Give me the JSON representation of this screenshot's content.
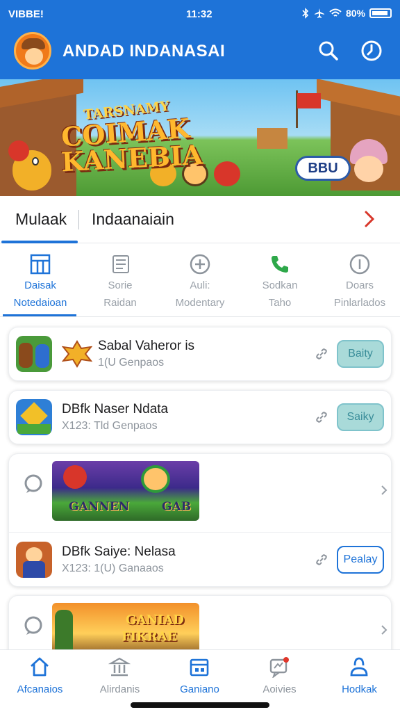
{
  "status_bar": {
    "carrier": "VIBBE!",
    "time": "11:32",
    "battery": "80%"
  },
  "header": {
    "title": "ANDAD INDANASAI",
    "icons": [
      "search-icon",
      "history-icon"
    ]
  },
  "banner": {
    "line1": "TARSNAMY",
    "line2": "COIMAK",
    "line3": "KANEBIA",
    "badge": "BBU"
  },
  "section_tabs": {
    "active": "Mulaak",
    "other": "Indaanaiain"
  },
  "categories": [
    {
      "line1": "Daisak",
      "line2": "Notedaioan",
      "icon": "grid-icon",
      "active": true
    },
    {
      "line1": "Sorie",
      "line2": "Raidan",
      "icon": "list-icon",
      "active": false
    },
    {
      "line1": "Auli:",
      "line2": "Modentary",
      "icon": "add-circle-icon",
      "active": false
    },
    {
      "line1": "Sodkan",
      "line2": "Taho",
      "icon": "phone-icon",
      "active": false
    },
    {
      "line1": "Doars",
      "line2": "Pinlarlados",
      "icon": "info-circle-icon",
      "active": false
    }
  ],
  "games": [
    {
      "title": "Sabal Vaheror is",
      "subtitle": "1(U  Genpaos",
      "button": "Baity",
      "icon": "game-thumb-1"
    },
    {
      "title": "DBfk  Naser Ndata",
      "subtitle": "X123:  Tld Genpaos",
      "button": "Saiky",
      "icon": "game-thumb-2"
    },
    {
      "title": "DBfk  Saiye: Nelasa",
      "subtitle": "X123:  1(U) Ganaaos",
      "button": "Pealay",
      "icon": "game-thumb-3"
    }
  ],
  "promo_cards": [
    {
      "left": "GANNEN",
      "right": "GAB"
    },
    {
      "line1": "GANIAD",
      "line2": "FIKRAE"
    }
  ],
  "bottom_nav": [
    {
      "label": "Afcanaios",
      "icon": "home-icon",
      "active": true
    },
    {
      "label": "Alirdanis",
      "icon": "bank-icon",
      "active": false
    },
    {
      "label": "Ganiano",
      "icon": "store-icon",
      "active": true
    },
    {
      "label": "Aoivies",
      "icon": "chat-icon",
      "active": false
    },
    {
      "label": "Hodkak",
      "icon": "user-icon",
      "active": true
    }
  ],
  "colors": {
    "primary": "#1e73d8",
    "tinted_button": "#a9dad9",
    "muted_text": "#8d949c"
  }
}
